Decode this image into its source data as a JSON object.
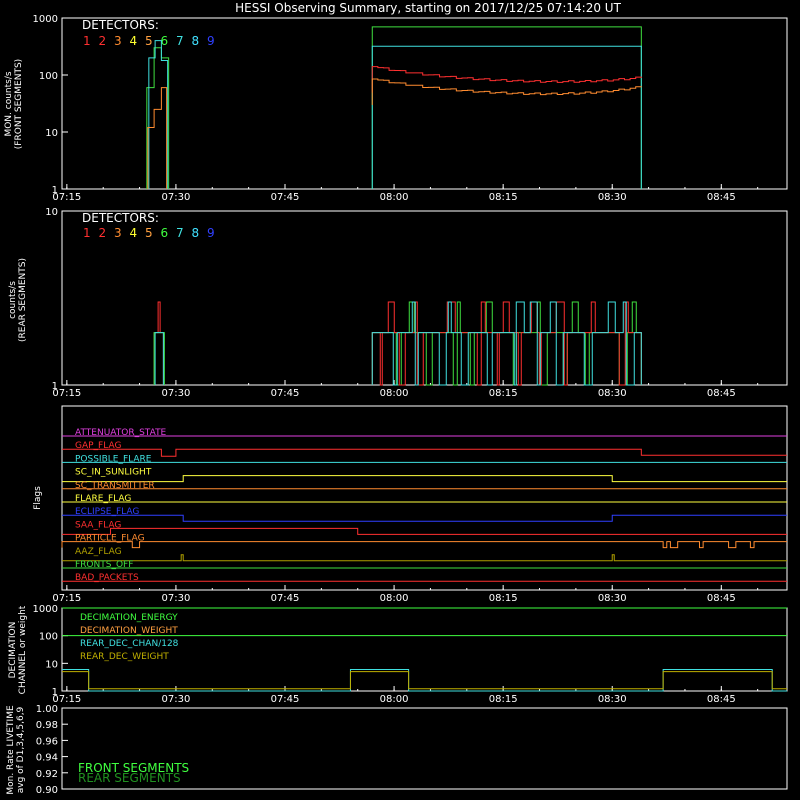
{
  "title": "HESSI Observing Summary, starting on 2017/12/25 07:14:20 UT",
  "colors": {
    "bg": "#000000",
    "axis": "#ffffff",
    "det": [
      "#ff3030",
      "#ff3030",
      "#ff8c30",
      "#ffff30",
      "#ffa040",
      "#40ff40",
      "#40e0e0",
      "#40e0ff",
      "#3040ff"
    ],
    "front_c1": "#ff3030",
    "front_c2": "#ff8c30",
    "front_c3": "#40e040",
    "front_c4": "#40e0e0",
    "rear_c1": "#ff3030",
    "rear_c2": "#40e040",
    "rear_c3": "#40e0e0",
    "rear_c4": "#ff8c30",
    "dec_energy": "#40ff40",
    "dec_weight": "#ffa040",
    "rear_dec_chan": "#40e0e0",
    "rear_dec_weight": "#c0b000",
    "live_front": "#40ff40",
    "live_rear": "#209020"
  },
  "time_ticks": [
    "07:15",
    "07:30",
    "07:45",
    "08:00",
    "08:15",
    "08:30",
    "08:45"
  ],
  "panel1": {
    "ylabel": "MON. counts/s\n(FRONT SEGMENTS)",
    "yticks": [
      "1000",
      "100",
      "10",
      "1"
    ],
    "legend_title": "DETECTORS:",
    "legend_digits": [
      "1",
      "2",
      "3",
      "4",
      "5",
      "6",
      "7",
      "8",
      "9"
    ]
  },
  "panel2": {
    "ylabel": "counts/s\n(REAR SEGMENTS)",
    "yticks": [
      "10",
      "1"
    ],
    "legend_title": "DETECTORS:",
    "legend_digits": [
      "1",
      "2",
      "3",
      "4",
      "5",
      "6",
      "7",
      "8",
      "9"
    ]
  },
  "panel3": {
    "ylabel": "Flags",
    "flags": [
      {
        "name": "ATTENUATOR_STATE",
        "color": "#e040e0"
      },
      {
        "name": "GAP_FLAG",
        "color": "#ff3030"
      },
      {
        "name": "POSSIBLE_FLARE",
        "color": "#40e0e0"
      },
      {
        "name": "SC_IN_SUNLIGHT",
        "color": "#ffff40"
      },
      {
        "name": "SC_TRANSMITTER",
        "color": "#ff8c30"
      },
      {
        "name": "FLARE_FLAG",
        "color": "#ffff40"
      },
      {
        "name": "ECLIPSE_FLAG",
        "color": "#3040ff"
      },
      {
        "name": "SAA_FLAG",
        "color": "#ff3030"
      },
      {
        "name": "PARTICLE_FLAG",
        "color": "#ff8c30"
      },
      {
        "name": "AAZ_FLAG",
        "color": "#b0a000"
      },
      {
        "name": "FRONTS_OFF",
        "color": "#40e040"
      },
      {
        "name": "BAD_PACKETS",
        "color": "#ff3030"
      }
    ]
  },
  "panel4": {
    "ylabel": "DECIMATION\nCHANNEL or weight",
    "yticks": [
      "1000",
      "100",
      "10",
      "1"
    ],
    "legend": [
      "DECIMATION_ENERGY",
      "DECIMATION_WEIGHT",
      "REAR_DEC_CHAN/128",
      "REAR_DEC_WEIGHT"
    ]
  },
  "panel5": {
    "ylabel": "Mon. Rate LIVETIME\navg of D1,3,4,5,6,9",
    "yticks": [
      "1.00",
      "0.98",
      "0.96",
      "0.94",
      "0.92",
      "0.90"
    ],
    "legend": [
      "FRONT SEGMENTS",
      "REAR SEGMENTS"
    ]
  },
  "chart_data": [
    {
      "type": "line",
      "title": "HESSI Observing Summary, starting on 2017/12/25 07:14:20 UT",
      "ylabel": "MON. counts/s (FRONT SEGMENTS)",
      "y_scale": "log",
      "ylim": [
        1,
        1000
      ],
      "xlim": [
        "07:14:20",
        "08:54:00"
      ],
      "series": [
        {
          "x": [
            "07:26",
            "07:27",
            "07:28",
            "07:29",
            "07:57",
            "08:00",
            "08:10",
            "08:20",
            "08:30",
            "08:34"
          ],
          "values": [
            1,
            50,
            260,
            1,
            120,
            130,
            90,
            70,
            90,
            90
          ]
        },
        {
          "x": [
            "07:26",
            "07:27",
            "07:28",
            "07:29",
            "07:57",
            "08:00",
            "08:10",
            "08:20",
            "08:30",
            "08:34"
          ],
          "values": [
            1,
            12,
            30,
            1,
            80,
            85,
            55,
            45,
            60,
            60
          ]
        },
        {
          "x": [
            "07:26",
            "07:27",
            "07:28",
            "07:29",
            "07:57",
            "08:00",
            "08:10",
            "08:20",
            "08:30",
            "08:34"
          ],
          "values": [
            1,
            300,
            700,
            1,
            700,
            700,
            700,
            700,
            700,
            700
          ]
        },
        {
          "x": [
            "07:26",
            "07:27",
            "07:28",
            "07:29",
            "07:57",
            "08:00",
            "08:10",
            "08:20",
            "08:30",
            "08:34"
          ],
          "values": [
            1,
            200,
            400,
            1,
            320,
            330,
            320,
            320,
            320,
            320
          ]
        }
      ]
    },
    {
      "type": "line",
      "ylabel": "counts/s (REAR SEGMENTS)",
      "y_scale": "log",
      "ylim": [
        1,
        10
      ],
      "series": [
        {
          "x": [
            "07:27",
            "07:28",
            "07:29",
            "07:57",
            "08:15",
            "08:34"
          ],
          "values": [
            2,
            3,
            1,
            3,
            2,
            3
          ]
        },
        {
          "x": [
            "07:27",
            "07:28",
            "07:29",
            "07:57",
            "08:15",
            "08:34"
          ],
          "values": [
            2,
            2,
            1,
            2,
            2,
            2
          ]
        },
        {
          "x": [
            "07:27",
            "07:28",
            "07:29",
            "07:57",
            "08:15",
            "08:34"
          ],
          "values": [
            2,
            2,
            1,
            3,
            2,
            3
          ]
        }
      ]
    },
    {
      "type": "line",
      "ylabel": "DECIMATION CHANNEL or weight",
      "y_scale": "log",
      "ylim": [
        1,
        1000
      ],
      "series": [
        {
          "name": "DECIMATION_ENERGY",
          "x": [
            "07:14",
            "08:54"
          ],
          "values": [
            1000,
            1000
          ]
        },
        {
          "name": "DECIMATION_WEIGHT",
          "x": [
            "07:14",
            "08:54"
          ],
          "values": [
            100,
            100
          ]
        },
        {
          "name": "REAR_DEC_CHAN/128",
          "x": [
            "07:14",
            "07:18",
            "07:54",
            "08:02",
            "08:37",
            "08:52"
          ],
          "values": [
            5,
            1,
            5,
            1,
            5,
            1
          ]
        },
        {
          "name": "REAR_DEC_WEIGHT",
          "x": [
            "07:14",
            "07:18",
            "07:54",
            "08:02",
            "08:37",
            "08:52"
          ],
          "values": [
            5,
            1,
            5,
            1,
            5,
            1
          ]
        }
      ]
    },
    {
      "type": "line",
      "ylabel": "Mon. Rate LIVETIME avg of D1,3,4,5,6,9",
      "ylim": [
        0.9,
        1.0
      ],
      "series": [
        {
          "name": "FRONT SEGMENTS",
          "values": []
        },
        {
          "name": "REAR SEGMENTS",
          "values": []
        }
      ]
    }
  ]
}
